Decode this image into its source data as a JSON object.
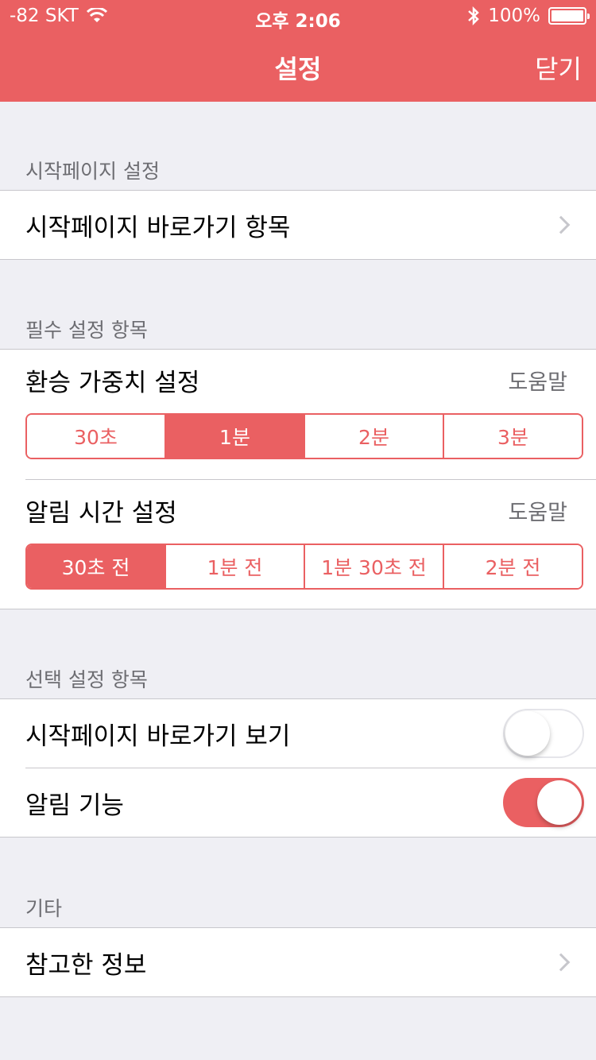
{
  "status": {
    "carrier": "-82 SKT",
    "time": "오후 2:06",
    "battery": "100%"
  },
  "nav": {
    "title": "설정",
    "close_label": "닫기"
  },
  "sections": {
    "start_page": {
      "header": "시작페이지 설정",
      "shortcut_items_label": "시작페이지 바로가기 항목"
    },
    "required": {
      "header": "필수 설정 항목",
      "transfer_weight": {
        "label": "환승 가중치 설정",
        "help": "도움말",
        "options": [
          "30초",
          "1분",
          "2분",
          "3분"
        ],
        "selected": "1분"
      },
      "alarm_time": {
        "label": "알림 시간 설정",
        "help": "도움말",
        "options": [
          "30초 전",
          "1분 전",
          "1분 30초 전",
          "2분 전"
        ],
        "selected": "30초 전"
      }
    },
    "optional": {
      "header": "선택 설정 항목",
      "show_shortcut": {
        "label": "시작페이지 바로가기 보기",
        "on": false
      },
      "alarm": {
        "label": "알림 기능",
        "on": true
      }
    },
    "etc": {
      "header": "기타",
      "references_label": "참고한 정보"
    }
  },
  "colors": {
    "accent": "#ea6062",
    "background": "#efeff4"
  }
}
